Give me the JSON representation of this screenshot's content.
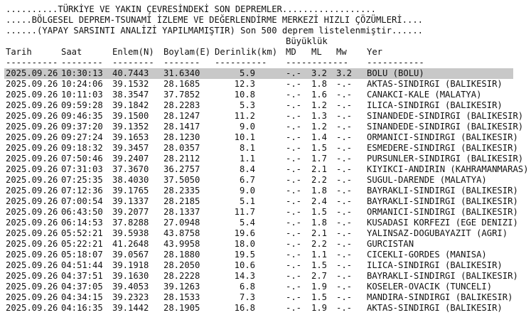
{
  "banner": [
    "..........TÜRKİYE VE YAKIN ÇEVRESİNDEKİ SON DEPREMLER..................",
    ".....BÖLGESEL DEPREM-TSUNAMİ İZLEME VE DEĞERLENDİRME MERKEZİ HIZLI ÇÖZÜMLERİ....",
    "......(YAPAY SARSINTI ANALİZİ YAPILMAMIŞTIR) Son 500 deprem listelenmiştir......"
  ],
  "magnitude_group_label": "Büyüklük",
  "headers": {
    "date": "Tarih",
    "time": "Saat",
    "lat": "Enlem(N)",
    "lon": "Boylam(E)",
    "depth": "Derinlik(km)",
    "md": "MD",
    "ml": "ML",
    "mw": "Mw",
    "place": "Yer"
  },
  "separators": {
    "date": "----------",
    "time": "--------",
    "lat": "--------",
    "lon": "-------",
    "depth": "----------",
    "mags": "------------",
    "place": "-----------"
  },
  "rows": [
    {
      "date": "2025.09.26",
      "time": "10:30:13",
      "lat": "40.7443",
      "lon": "31.6340",
      "depth": "5.9",
      "md": "-.-",
      "ml": "3.2",
      "mw": "3.2",
      "place": "BOLU (BOLU)"
    },
    {
      "date": "2025.09.26",
      "time": "10:24:06",
      "lat": "39.1532",
      "lon": "28.1685",
      "depth": "12.3",
      "md": "-.-",
      "ml": "1.8",
      "mw": "-.-",
      "place": "AKTAS-SINDIRGI (BALIKESIR)"
    },
    {
      "date": "2025.09.26",
      "time": "10:11:03",
      "lat": "38.3547",
      "lon": "37.7852",
      "depth": "10.8",
      "md": "-.-",
      "ml": "1.6",
      "mw": "-.-",
      "place": "CANAKCI-KALE (MALATYA)"
    },
    {
      "date": "2025.09.26",
      "time": "09:59:28",
      "lat": "39.1842",
      "lon": "28.2283",
      "depth": "5.3",
      "md": "-.-",
      "ml": "1.2",
      "mw": "-.-",
      "place": "ILICA-SINDIRGI (BALIKESIR)"
    },
    {
      "date": "2025.09.26",
      "time": "09:46:35",
      "lat": "39.1500",
      "lon": "28.1247",
      "depth": "11.2",
      "md": "-.-",
      "ml": "1.3",
      "mw": "-.-",
      "place": "SINANDEDE-SINDIRGI (BALIKESIR)"
    },
    {
      "date": "2025.09.26",
      "time": "09:37:20",
      "lat": "39.1352",
      "lon": "28.1417",
      "depth": "9.0",
      "md": "-.-",
      "ml": "1.2",
      "mw": "-.-",
      "place": "SINANDEDE-SINDIRGI (BALIKESIR)"
    },
    {
      "date": "2025.09.26",
      "time": "09:27:24",
      "lat": "39.1653",
      "lon": "28.1230",
      "depth": "10.1",
      "md": "-.-",
      "ml": "1.4",
      "mw": "-.-",
      "place": "ORMANICI-SINDIRGI (BALIKESIR)"
    },
    {
      "date": "2025.09.26",
      "time": "09:18:32",
      "lat": "39.3457",
      "lon": "28.0357",
      "depth": "8.1",
      "md": "-.-",
      "ml": "1.5",
      "mw": "-.-",
      "place": "ESMEDERE-SINDIRGI (BALIKESIR)"
    },
    {
      "date": "2025.09.26",
      "time": "07:50:46",
      "lat": "39.2407",
      "lon": "28.2112",
      "depth": "1.1",
      "md": "-.-",
      "ml": "1.7",
      "mw": "-.-",
      "place": "PURSUNLER-SINDIRGI (BALIKESIR)"
    },
    {
      "date": "2025.09.26",
      "time": "07:31:03",
      "lat": "37.3670",
      "lon": "36.2757",
      "depth": "8.4",
      "md": "-.-",
      "ml": "2.1",
      "mw": "-.-",
      "place": "KIYIKCI-ANDIRIN (KAHRAMANMARAS)"
    },
    {
      "date": "2025.09.26",
      "time": "07:25:35",
      "lat": "38.4030",
      "lon": "37.5050",
      "depth": "6.7",
      "md": "-.-",
      "ml": "2.2",
      "mw": "-.-",
      "place": "SUGUL-DARENDE (MALATYA)"
    },
    {
      "date": "2025.09.26",
      "time": "07:12:36",
      "lat": "39.1765",
      "lon": "28.2335",
      "depth": "9.0",
      "md": "-.-",
      "ml": "1.8",
      "mw": "-.-",
      "place": "BAYRAKLI-SINDIRGI (BALIKESIR)"
    },
    {
      "date": "2025.09.26",
      "time": "07:00:54",
      "lat": "39.1337",
      "lon": "28.2185",
      "depth": "5.1",
      "md": "-.-",
      "ml": "2.4",
      "mw": "-.-",
      "place": "BAYRAKLI-SINDIRGI (BALIKESIR)"
    },
    {
      "date": "2025.09.26",
      "time": "06:43:50",
      "lat": "39.2077",
      "lon": "28.1337",
      "depth": "11.7",
      "md": "-.-",
      "ml": "1.5",
      "mw": "-.-",
      "place": "ORMANICI-SINDIRGI (BALIKESIR)"
    },
    {
      "date": "2025.09.26",
      "time": "06:14:53",
      "lat": "37.8288",
      "lon": "27.0948",
      "depth": "5.4",
      "md": "-.-",
      "ml": "1.8",
      "mw": "-.-",
      "place": "KUSADASI KORFEZI (EGE DENIZI)"
    },
    {
      "date": "2025.09.26",
      "time": "05:52:21",
      "lat": "39.5938",
      "lon": "43.8758",
      "depth": "19.6",
      "md": "-.-",
      "ml": "2.1",
      "mw": "-.-",
      "place": "YALINSAZ-DOGUBAYAZIT (AGRI)"
    },
    {
      "date": "2025.09.26",
      "time": "05:22:21",
      "lat": "41.2648",
      "lon": "43.9958",
      "depth": "18.0",
      "md": "-.-",
      "ml": "2.2",
      "mw": "-.-",
      "place": "GURCISTAN"
    },
    {
      "date": "2025.09.26",
      "time": "05:18:07",
      "lat": "39.0567",
      "lon": "28.1880",
      "depth": "19.5",
      "md": "-.-",
      "ml": "1.1",
      "mw": "-.-",
      "place": "CICEKLI-GORDES (MANISA)"
    },
    {
      "date": "2025.09.26",
      "time": "04:51:44",
      "lat": "39.1918",
      "lon": "28.2050",
      "depth": "10.6",
      "md": "-.-",
      "ml": "1.5",
      "mw": "-.-",
      "place": "ILICA-SINDIRGI (BALIKESIR)"
    },
    {
      "date": "2025.09.26",
      "time": "04:37:51",
      "lat": "39.1630",
      "lon": "28.2228",
      "depth": "14.3",
      "md": "-.-",
      "ml": "2.7",
      "mw": "-.-",
      "place": "BAYRAKLI-SINDIRGI (BALIKESIR)"
    },
    {
      "date": "2025.09.26",
      "time": "04:37:05",
      "lat": "39.4053",
      "lon": "39.1263",
      "depth": "6.8",
      "md": "-.-",
      "ml": "1.9",
      "mw": "-.-",
      "place": "KOSELER-OVACIK (TUNCELI)"
    },
    {
      "date": "2025.09.26",
      "time": "04:34:15",
      "lat": "39.2323",
      "lon": "28.1533",
      "depth": "7.3",
      "md": "-.-",
      "ml": "1.5",
      "mw": "-.-",
      "place": "MANDIRA-SINDIRGI (BALIKESIR)"
    },
    {
      "date": "2025.09.26",
      "time": "04:16:35",
      "lat": "39.1442",
      "lon": "28.1905",
      "depth": "16.8",
      "md": "-.-",
      "ml": "1.9",
      "mw": "-.-",
      "place": "AKTAS-SINDIRGI (BALIKESIR)"
    }
  ]
}
